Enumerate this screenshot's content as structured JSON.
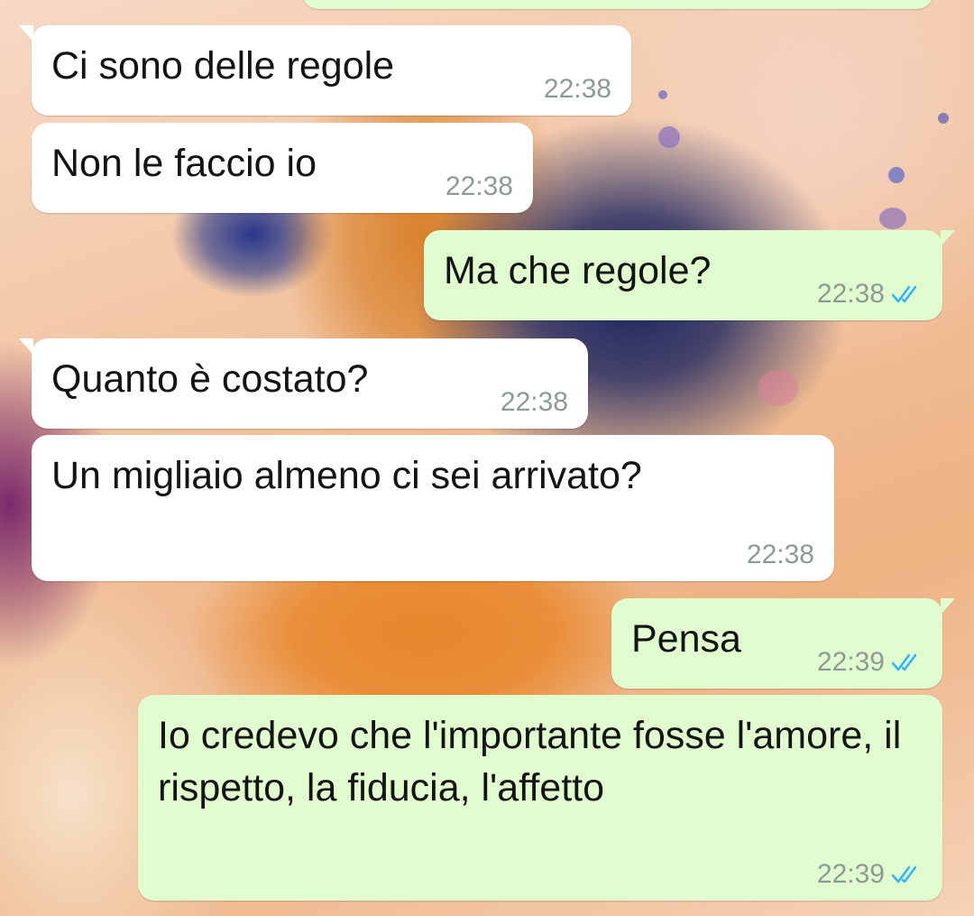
{
  "accent": {
    "read_ticks": "#34b7f1",
    "incoming_bg": "#ffffff",
    "outgoing_bg": "#e1fdcf",
    "time_color": "#8e9a95"
  },
  "messages": [
    {
      "direction": "in",
      "text": "Ci sono delle regole",
      "time": "22:38"
    },
    {
      "direction": "in",
      "text": "Non le faccio io",
      "time": "22:38"
    },
    {
      "direction": "out",
      "text": "Ma che regole?",
      "time": "22:38",
      "status_icon": "double-check-read-icon"
    },
    {
      "direction": "in",
      "text": "Quanto è costato?",
      "time": "22:38"
    },
    {
      "direction": "in",
      "text": "Un migliaio almeno ci sei arrivato?",
      "time": "22:38"
    },
    {
      "direction": "out",
      "text": "Pensa",
      "time": "22:39",
      "status_icon": "double-check-read-icon"
    },
    {
      "direction": "out",
      "text": "Io credevo che l'importante fosse l'amore, il rispetto, la fiducia, l'affetto",
      "time": "22:39",
      "status_icon": "double-check-read-icon"
    }
  ]
}
